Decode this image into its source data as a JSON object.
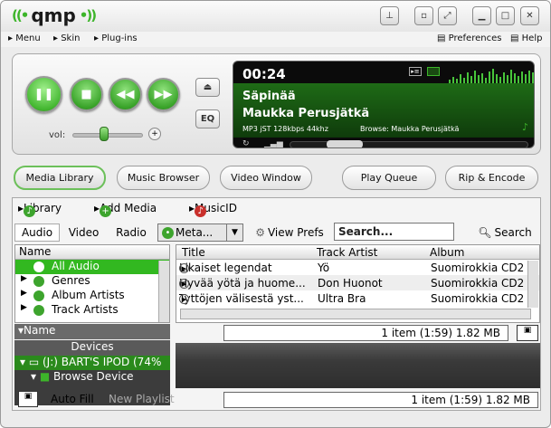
{
  "app": {
    "name": "qmp"
  },
  "menubar": {
    "menu": "Menu",
    "skin": "Skin",
    "plugins": "Plug-ins",
    "preferences": "Preferences",
    "help": "Help"
  },
  "player": {
    "time": "00:24",
    "title": "Säpinää",
    "artist": "Maukka Perusjätkä",
    "format": "MP3 jST 128kbps 44khz",
    "browse": "Browse: Maukka Perusjätkä",
    "vol_label": "vol:",
    "eq_label": "EQ",
    "volume_level": 0.55,
    "seek_progress": 0.4
  },
  "tabs": [
    "Media Library",
    "Music Browser",
    "Video Window",
    "Play Queue",
    "Rip & Encode"
  ],
  "library": {
    "links": [
      "Library",
      "Add Media",
      "MusicID"
    ],
    "filters": [
      "Audio",
      "Video",
      "Radio",
      "Meta..."
    ],
    "view_prefs": "View Prefs",
    "search_placeholder": "Search...",
    "search_button": "Search",
    "side_header": "Name",
    "side_items": [
      "All Audio",
      "Genres",
      "Album Artists",
      "Track Artists"
    ],
    "name_header": "Name",
    "devices_header": "Devices",
    "devices": [
      "(J:) BART'S IPOD (74%",
      "Browse Device"
    ],
    "columns": [
      "Title",
      "Track Artist",
      "Album"
    ],
    "rows": [
      {
        "title": "Likaiset legendat",
        "artist": "Yö",
        "album": "Suomirokkia CD2"
      },
      {
        "title": "Hyvää yötä ja huome...",
        "artist": "Don Huonot",
        "album": "Suomirokkia CD2"
      },
      {
        "title": "Tyttöjen välisestä yst...",
        "artist": "Ultra Bra",
        "album": "Suomirokkia CD2"
      }
    ],
    "status_top": "1 item (1:59) 1.82 MB",
    "auto_fill": "Auto Fill",
    "new_playlist": "New Playlist",
    "status_bottom": "1 item (1:59) 1.82 MB"
  },
  "colors": {
    "accent": "#3db52a",
    "display_bg": "#0b0b0b",
    "selected_row": "#32b820"
  }
}
